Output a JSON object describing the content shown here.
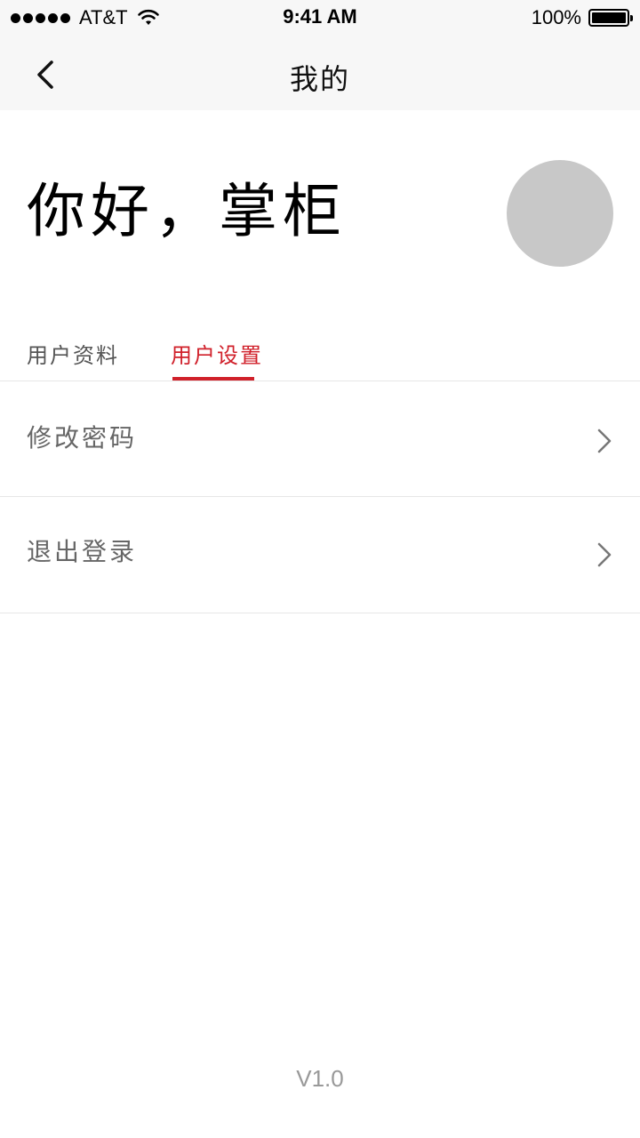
{
  "status_bar": {
    "carrier": "AT&T",
    "time": "9:41 AM",
    "battery": "100%"
  },
  "nav": {
    "title": "我的"
  },
  "header": {
    "greeting": "你好，掌柜"
  },
  "tabs": [
    {
      "label": "用户资料",
      "active": false
    },
    {
      "label": "用户设置",
      "active": true
    }
  ],
  "settings_list": [
    {
      "label": "修改密码"
    },
    {
      "label": "退出登录"
    }
  ],
  "footer": {
    "version": "V1.0"
  },
  "colors": {
    "accent": "#d0202a",
    "avatar_placeholder": "#c8c8c8",
    "nav_background": "#f7f7f7"
  }
}
